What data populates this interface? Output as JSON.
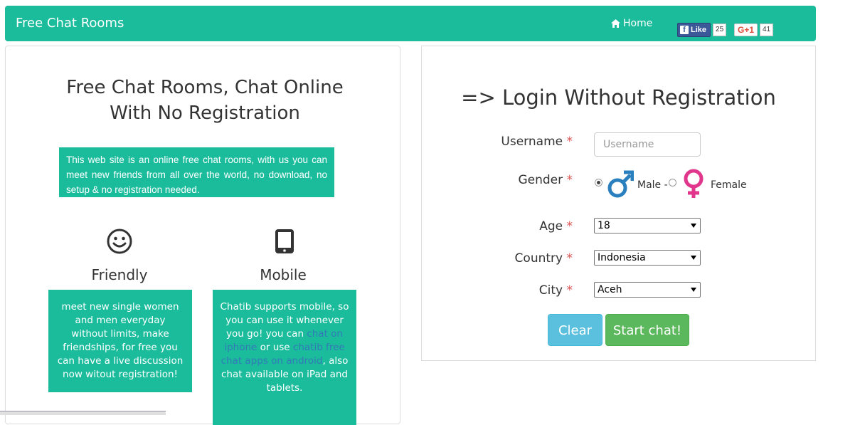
{
  "navbar": {
    "brand": "Free Chat Rooms",
    "home_label": "Home",
    "fb_like_label": "Like",
    "fb_like_count": "25",
    "gplus_label": "G+1",
    "gplus_count": "41"
  },
  "left": {
    "title": "Free Chat Rooms, Chat Online With No Registration",
    "intro": "This web site is an online free chat rooms, with us you can meet new friends from all over the world, no download, no setup & no registration needed.",
    "features": [
      {
        "icon": "smile-icon",
        "title": "Friendly",
        "text": "meet new single women and men everyday without limits, make friendships, for free you can have a live discussion now witout registration!"
      },
      {
        "icon": "tablet-icon",
        "title": "Mobile",
        "text_before": "Chatib supports mobile, so you can use it whenever you go! you can ",
        "link1": "chat on iphone",
        "text_mid": " or use ",
        "link2": "chatib free chat apps on android",
        "text_after": ", also chat available on iPad and tablets."
      }
    ]
  },
  "login": {
    "title": "=> Login Without Registration",
    "username_label": "Username",
    "username_placeholder": "Username",
    "gender_label": "Gender",
    "male_label": "Male -",
    "female_label": "Female",
    "age_label": "Age",
    "age_value": "18",
    "country_label": "Country",
    "country_value": "Indonesia",
    "city_label": "City",
    "city_value": "Aceh",
    "required_mark": "*",
    "clear_button": "Clear",
    "start_button": "Start chat!"
  },
  "colors": {
    "accent": "#1abc9c",
    "info": "#5bc0de",
    "success": "#5cb85c",
    "required": "#d9534f",
    "male_icon": "#2a7fbf",
    "female_icon": "#e0378c"
  }
}
